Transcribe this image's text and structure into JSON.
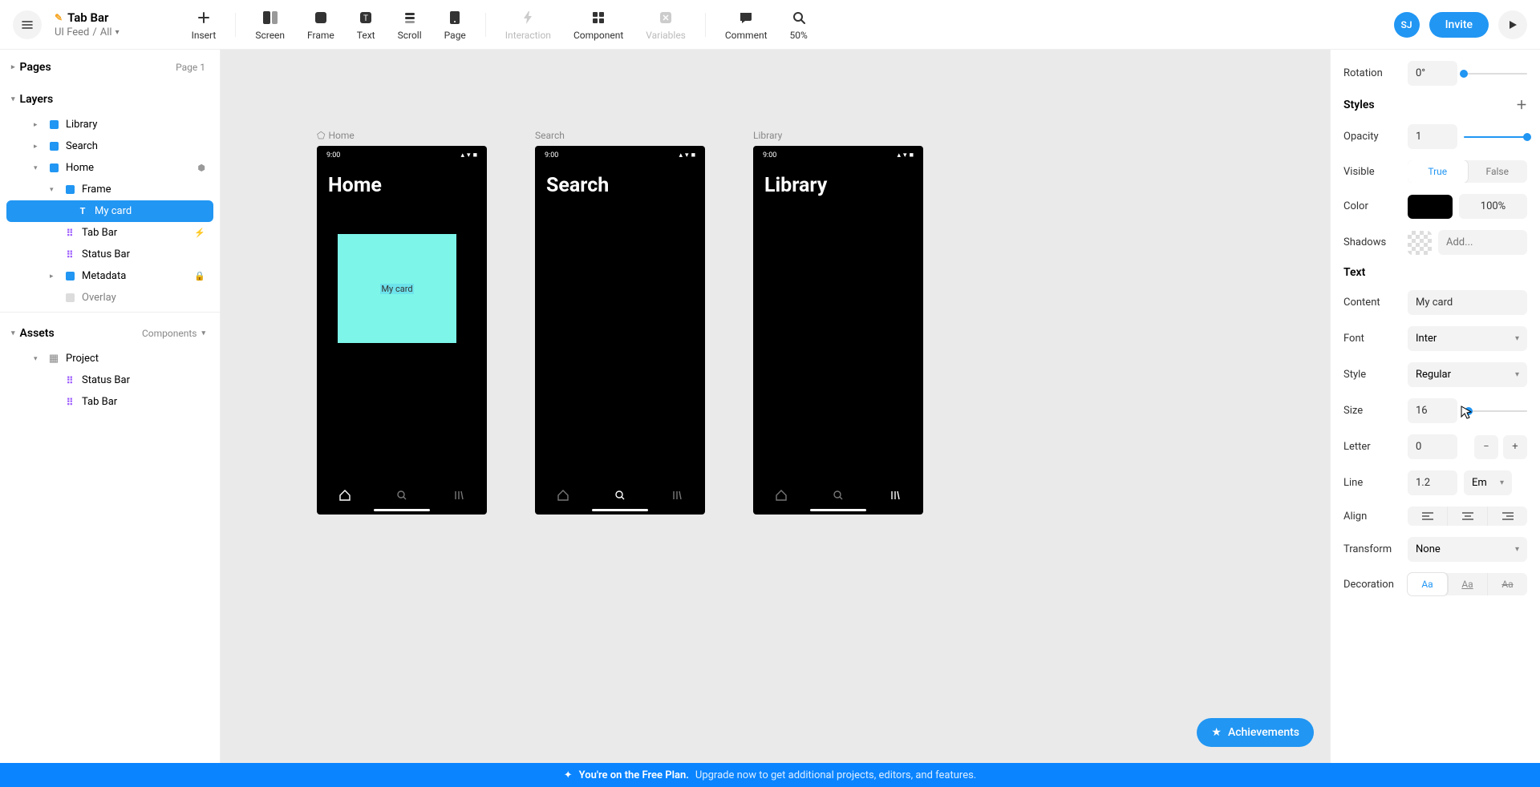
{
  "header": {
    "project_title": "Tab Bar",
    "breadcrumb_a": "UI Feed",
    "breadcrumb_b": "All",
    "avatar": "SJ",
    "invite": "Invite"
  },
  "toolbar": {
    "insert": "Insert",
    "screen": "Screen",
    "frame": "Frame",
    "text": "Text",
    "scroll": "Scroll",
    "page": "Page",
    "interaction": "Interaction",
    "component": "Component",
    "variables": "Variables",
    "comment": "Comment",
    "zoom": "50%"
  },
  "left": {
    "pages": "Pages",
    "page_indicator": "Page 1",
    "layers": "Layers",
    "assets": "Assets",
    "components": "Components",
    "tree": {
      "library": "Library",
      "search": "Search",
      "home": "Home",
      "frame": "Frame",
      "my_card": "My card",
      "tab_bar": "Tab Bar",
      "status_bar": "Status Bar",
      "metadata": "Metadata",
      "overlay": "Overlay",
      "project": "Project",
      "a_status_bar": "Status Bar",
      "a_tab_bar": "Tab Bar"
    }
  },
  "canvas": {
    "labels": {
      "home": "Home",
      "search": "Search",
      "library": "Library"
    },
    "time": "9:00",
    "titles": {
      "home": "Home",
      "search": "Search",
      "library": "Library"
    },
    "card_text": "My card",
    "achievements": "Achievements"
  },
  "right": {
    "rotation": {
      "label": "Rotation",
      "value": "0°"
    },
    "styles": "Styles",
    "opacity": {
      "label": "Opacity",
      "value": "1"
    },
    "visible": {
      "label": "Visible",
      "true": "True",
      "false": "False"
    },
    "color": {
      "label": "Color",
      "pct": "100%"
    },
    "shadows": {
      "label": "Shadows",
      "placeholder": "Add..."
    },
    "text_section": "Text",
    "content": {
      "label": "Content",
      "value": "My card"
    },
    "font": {
      "label": "Font",
      "value": "Inter"
    },
    "style": {
      "label": "Style",
      "value": "Regular"
    },
    "size": {
      "label": "Size",
      "value": "16"
    },
    "letter": {
      "label": "Letter",
      "value": "0"
    },
    "line": {
      "label": "Line",
      "value": "1.2",
      "unit": "Em"
    },
    "align": {
      "label": "Align"
    },
    "transform": {
      "label": "Transform",
      "value": "None"
    },
    "decoration": {
      "label": "Decoration",
      "a": "Aa",
      "b": "Aa",
      "c": "Aa"
    }
  },
  "banner": {
    "bold": "You're on the Free Plan.",
    "rest": "Upgrade now to get additional projects, editors, and features."
  }
}
